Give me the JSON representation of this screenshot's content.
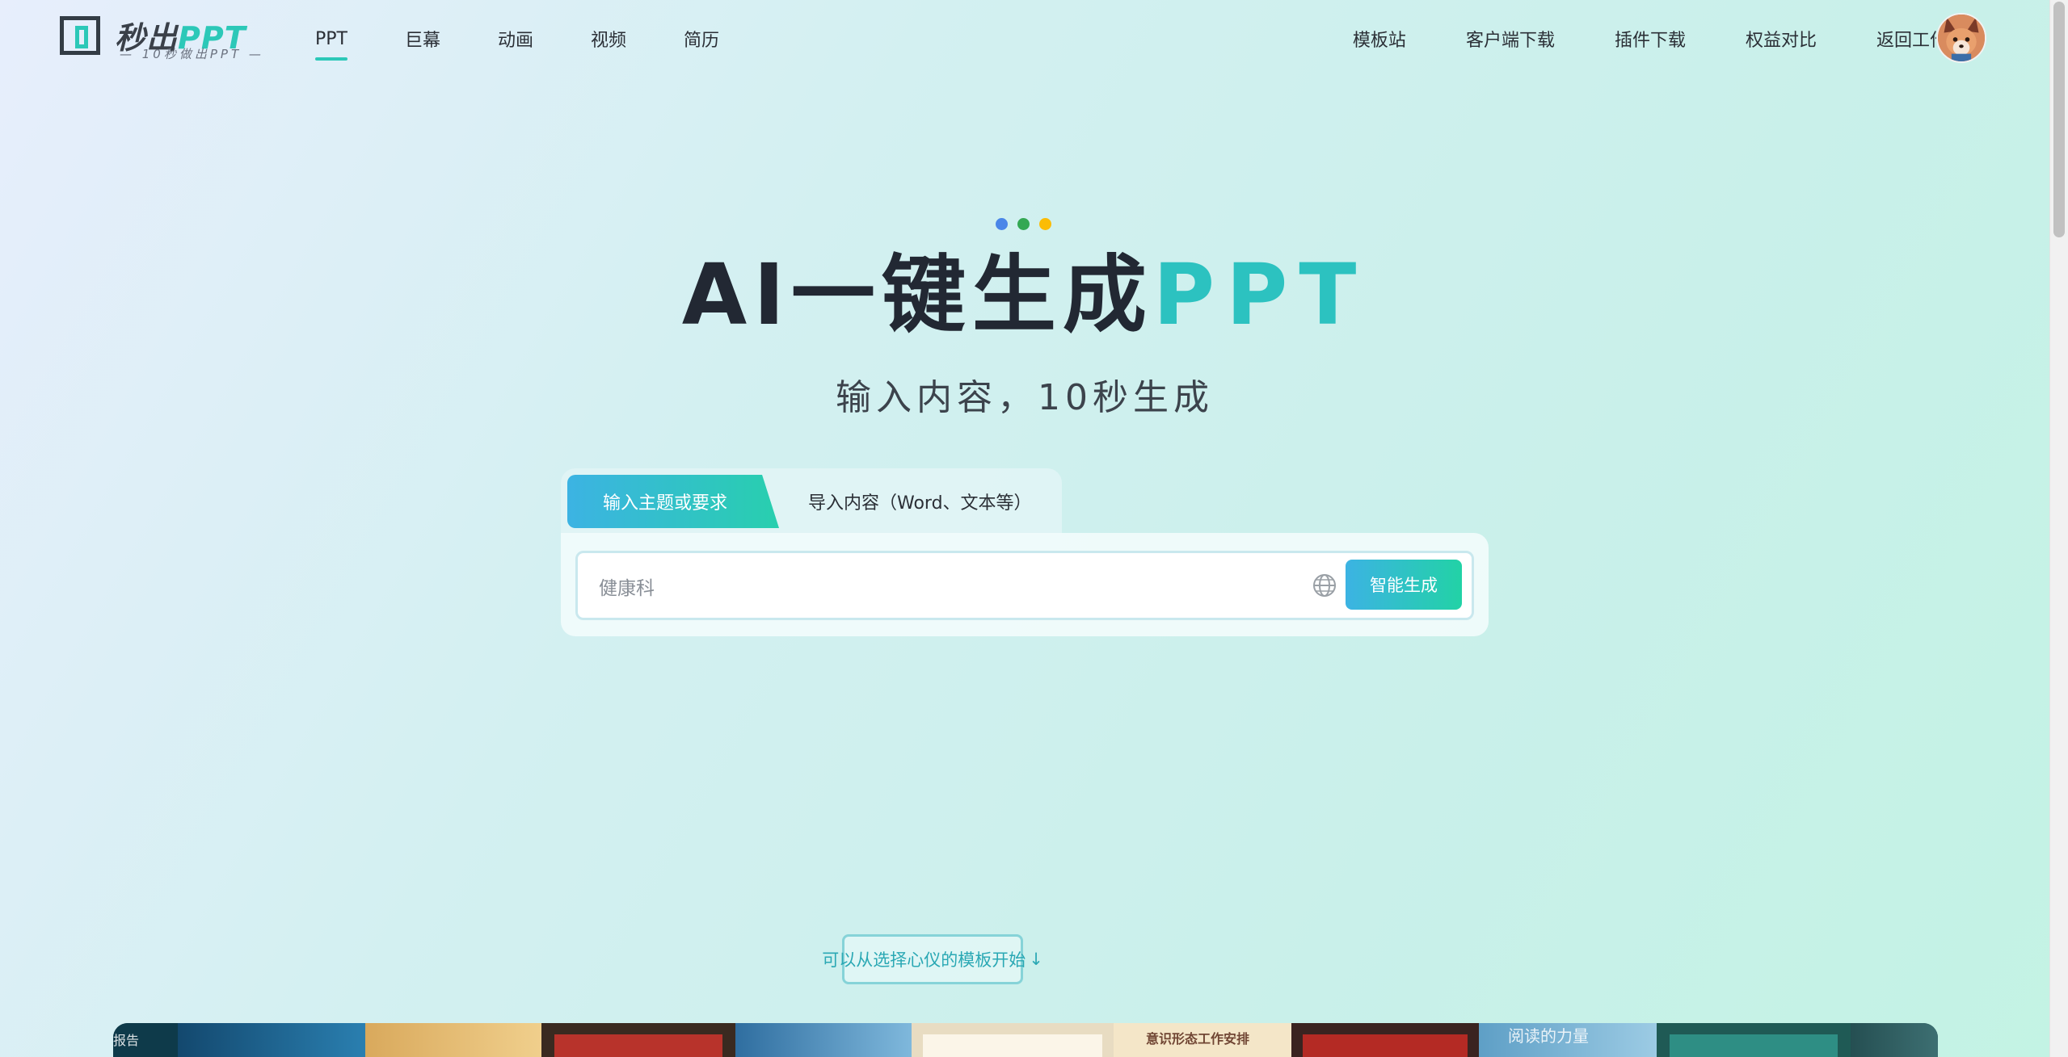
{
  "header": {
    "logo": {
      "name_cn": "秒出",
      "name_en": "PPT",
      "tagline": "— 10秒做出PPT —"
    },
    "nav_left": [
      "PPT",
      "巨幕",
      "动画",
      "视频",
      "简历"
    ],
    "nav_left_active": "PPT",
    "nav_right": [
      "模板站",
      "客户端下载",
      "插件下载",
      "权益对比",
      "返回工作台"
    ]
  },
  "hero": {
    "dot_colors": [
      "#4a86e8",
      "#34a853",
      "#fbbc05"
    ],
    "title_main": "AI一键生成",
    "title_accent": "PPT",
    "subtitle": "输入内容，10秒生成"
  },
  "input_card": {
    "tab_active": "输入主题或要求",
    "tab_inactive": "导入内容（Word、文本等）",
    "input_value": "健康科",
    "generate_button": "智能生成"
  },
  "template_hint": {
    "label": "可以从选择心仪的模板开始",
    "arrow": "↓"
  },
  "template_strip": {
    "thumbnails": [
      {
        "label": "报告",
        "color": "#0e3a4a"
      },
      {
        "label": "",
        "color": "#1c5f86"
      },
      {
        "label": "",
        "color": "#e2b76a"
      },
      {
        "label": "",
        "color": "#b8332b"
      },
      {
        "label": "",
        "color": "#5ea0c9"
      },
      {
        "label": "",
        "color": "#f3e7cf"
      },
      {
        "label": "意识形态工作安排",
        "color": "#f4e6c8"
      },
      {
        "label": "",
        "color": "#b42a24"
      },
      {
        "label": "阅读的力量",
        "color": "#7fb7d6"
      },
      {
        "label": "",
        "color": "#2e8e84"
      },
      {
        "label": "",
        "color": "#1f4a4c"
      }
    ]
  },
  "colors": {
    "accent": "#2cc8b8",
    "text_dark": "#222833"
  }
}
